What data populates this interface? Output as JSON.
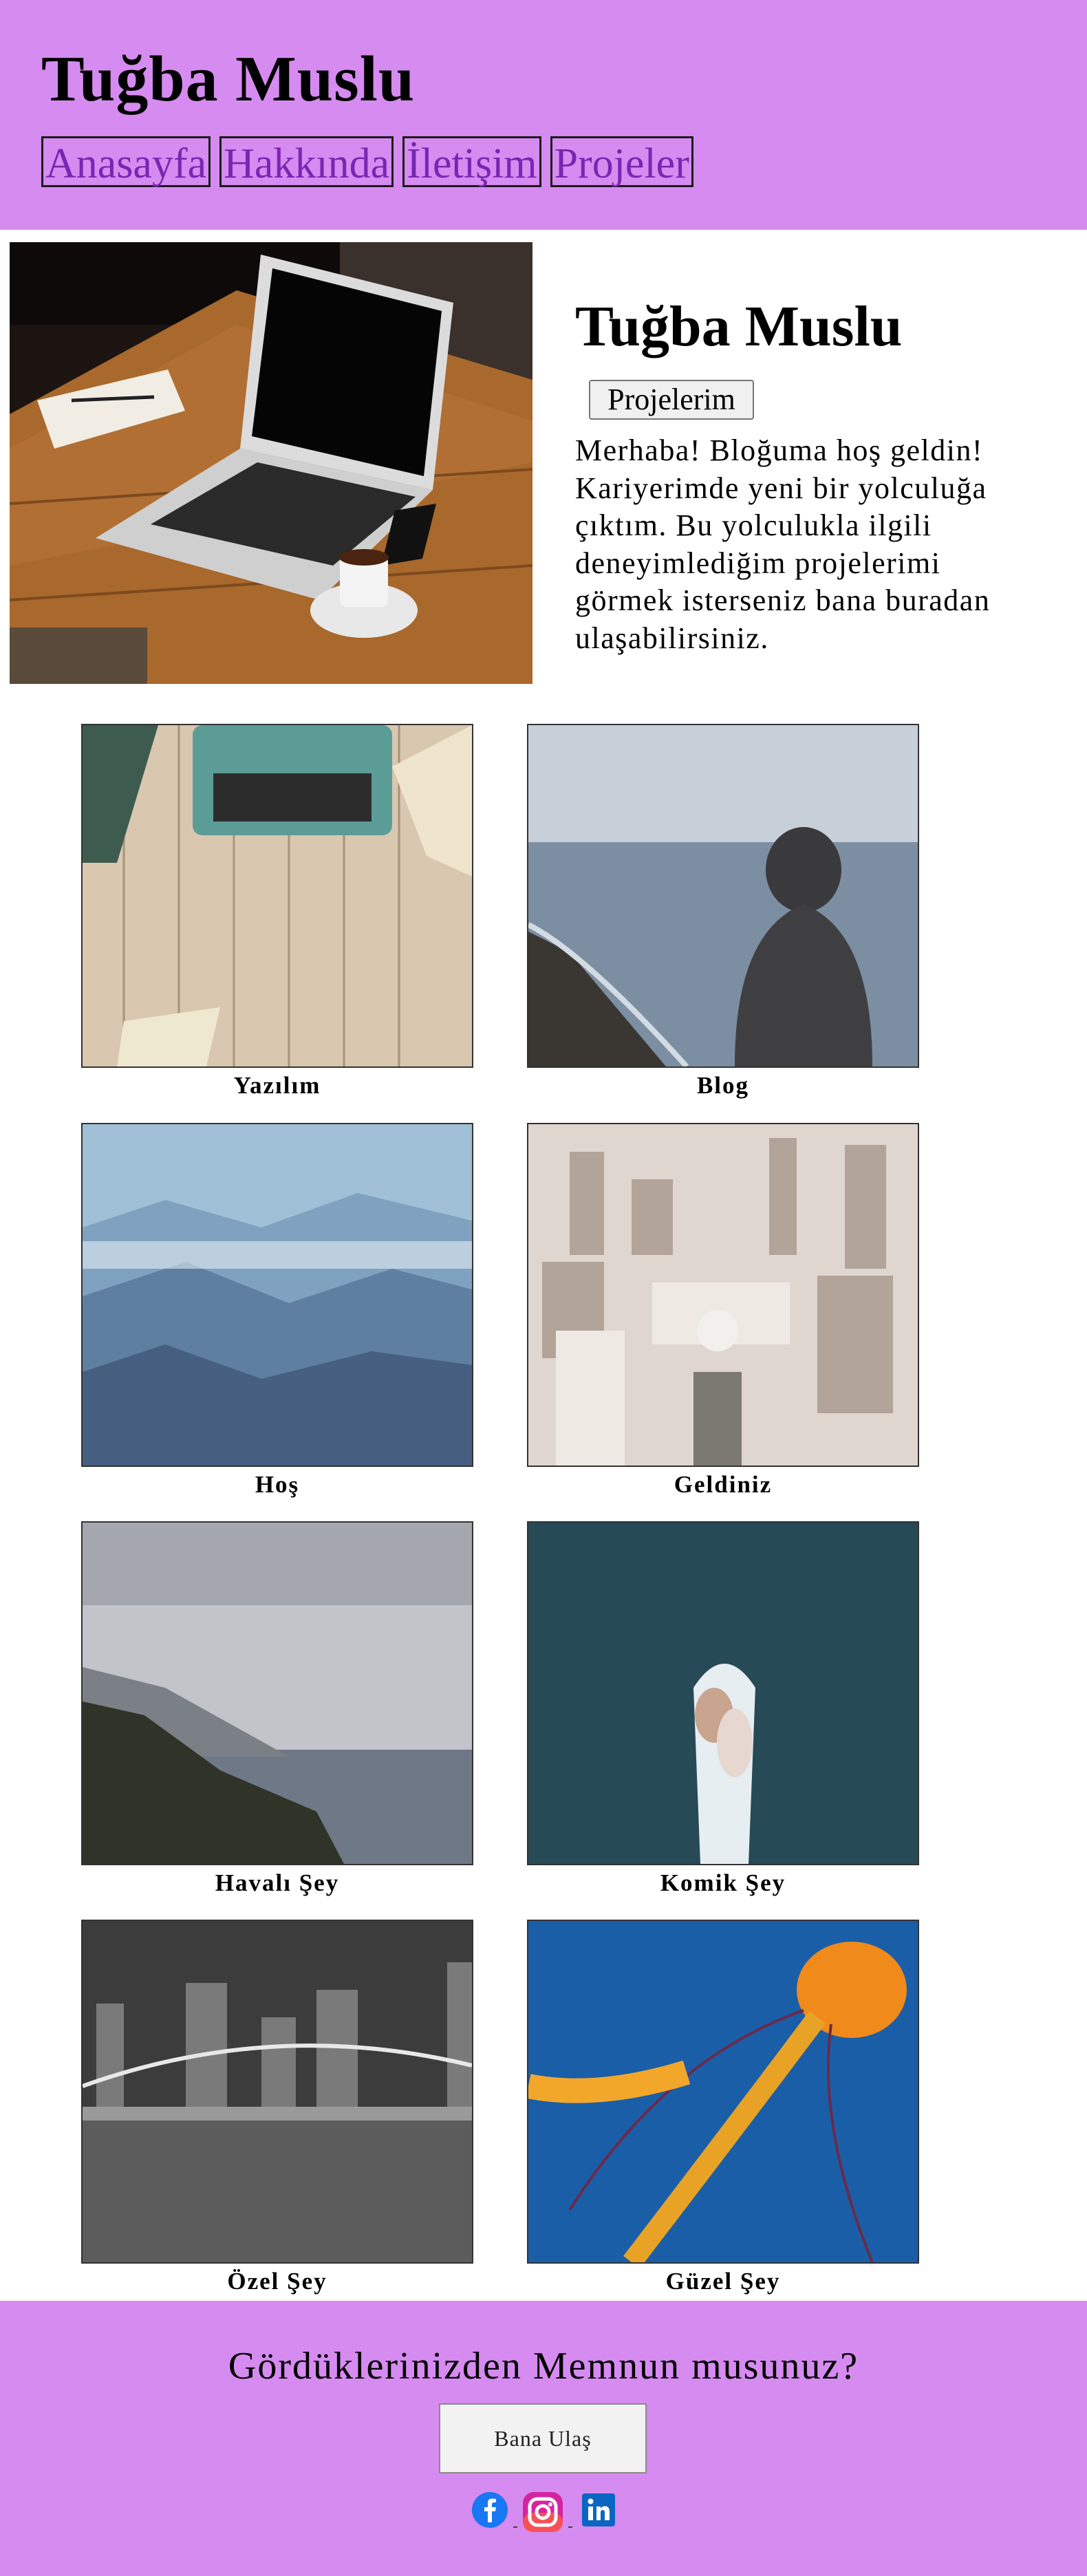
{
  "header": {
    "title": "Tuğba Muslu",
    "nav": [
      "Anasayfa",
      "Hakkında",
      "İletişim",
      "Projeler"
    ]
  },
  "hero": {
    "title": "Tuğba Muslu",
    "button_label": "Projelerim",
    "text": "Merhaba! Bloğuma hoş geldin! Kariyerimde yeni bir yolculuğa çıktım. Bu yolculukla ilgili deneyimlediğim projelerimi görmek isterseniz bana buradan ulaşabilirsiniz."
  },
  "gallery": [
    "Yazılım",
    "Blog",
    "Hoş",
    "Geldiniz",
    "Havalı Şey",
    "Komik Şey",
    "Özel Şey",
    "Güzel Şey"
  ],
  "footer": {
    "question": "Gördüklerinizden Memnun musunuz?",
    "button_label": "Bana Ulaş"
  },
  "social": [
    "facebook-icon",
    "instagram-icon",
    "linkedin-icon"
  ],
  "colors": {
    "header_bg": "#d68bf0",
    "nav_link": "#7b25b3",
    "facebook": "#1877f2",
    "linkedin": "#0a66c2"
  }
}
